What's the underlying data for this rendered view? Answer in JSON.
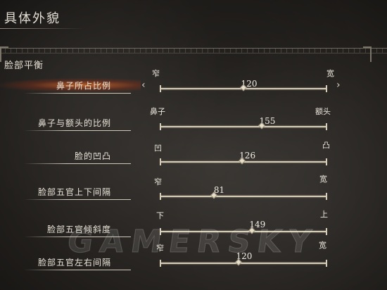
{
  "page_title": "具体外貌",
  "section_title": "脸部平衡",
  "watermark": "GAMERSKY",
  "accent_color": "#e0702a",
  "sliders": [
    {
      "label": "鼻子所占比例",
      "left": "窄",
      "right": "宽",
      "value": "120",
      "level": 0.5,
      "selected": true
    },
    {
      "label": "鼻子与额头的比例",
      "left": "鼻子",
      "right": "额头",
      "value": "155",
      "level": 0.61,
      "selected": false
    },
    {
      "label": "脸的凹凸",
      "left": "凹",
      "right": "凸",
      "value": "126",
      "level": 0.49,
      "selected": false
    },
    {
      "label": "脸部五官上下间隔",
      "left": "窄",
      "right": "宽",
      "value": "81",
      "level": 0.32,
      "selected": false
    },
    {
      "label": "脸部五官倾斜度",
      "left": "下",
      "right": "上",
      "value": "149",
      "level": 0.55,
      "selected": false
    },
    {
      "label": "脸部五官左右间隔",
      "left": "窄",
      "right": "宽",
      "value": "120",
      "level": 0.47,
      "selected": false
    }
  ]
}
